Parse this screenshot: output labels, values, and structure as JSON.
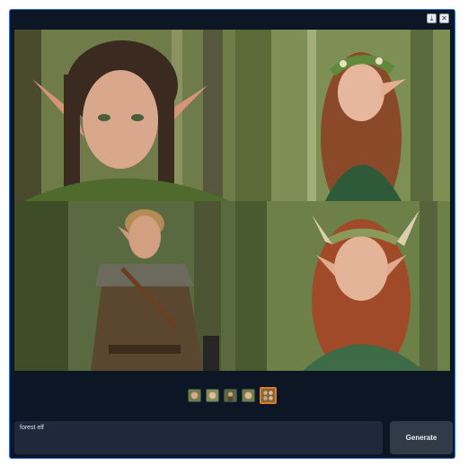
{
  "window": {
    "controls": [
      {
        "icon": "download-icon",
        "glyph": "⤓"
      },
      {
        "icon": "close-icon",
        "glyph": "✕"
      }
    ]
  },
  "gallery": {
    "images": [
      {
        "subject": "elf-boy-portrait",
        "palette": {
          "bg": "#6f7c4a",
          "face": "#d8a78c",
          "hair": "#3a2a20",
          "cloth": "#4e6a2c"
        }
      },
      {
        "subject": "elf-woman-flower-crown",
        "palette": {
          "bg": "#7e8f55",
          "face": "#e6b79c",
          "hair": "#8a4a2a",
          "cloth": "#2e5a3a"
        }
      },
      {
        "subject": "elf-man-archer",
        "palette": {
          "bg": "#5a6a40",
          "face": "#d2a081",
          "hair": "#b58a54",
          "cloth": "#5b4630"
        }
      },
      {
        "subject": "elf-woman-leaf-crown",
        "palette": {
          "bg": "#6d8047",
          "face": "#e4b498",
          "hair": "#a04a2a",
          "cloth": "#3c6b46"
        }
      }
    ]
  },
  "thumbnails": {
    "count": 5,
    "active_index": 4
  },
  "prompt": {
    "value": "forest elf"
  },
  "actions": {
    "generate_label": "Generate"
  }
}
